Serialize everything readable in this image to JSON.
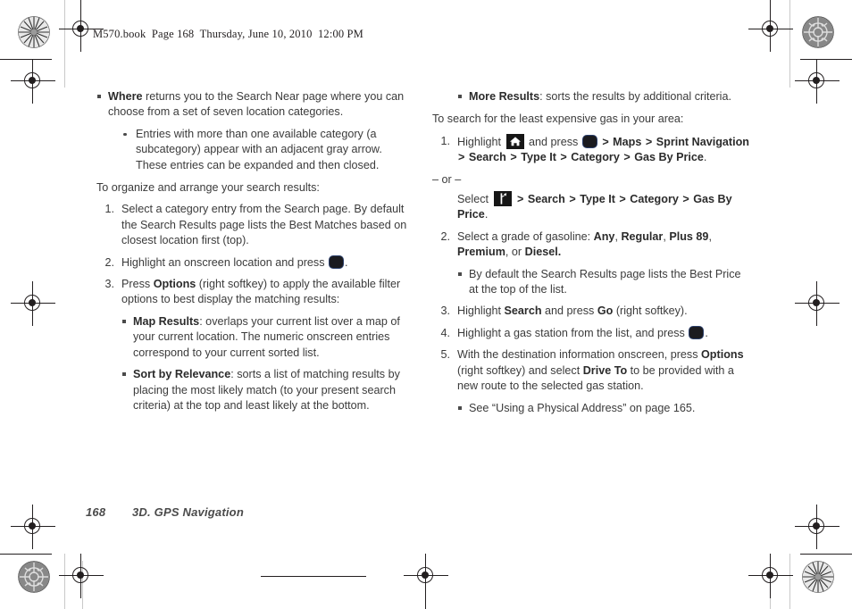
{
  "header": {
    "text": "M570.book  Page 168  Thursday, June 10, 2010  12:00 PM"
  },
  "footer": {
    "page_number": "168",
    "section": "3D. GPS Navigation"
  },
  "icons": {
    "ok_key": "ok-key-icon",
    "home": "home-icon",
    "navigation": "navigation-fork-icon"
  },
  "left_column": {
    "bullet_where": {
      "bold": "Where",
      "text": " returns you to the Search Near page where you can choose from a set of seven location categories."
    },
    "bullet_entries": "Entries with more than one available category (a subcategory) appear with an adjacent gray arrow. These entries can be expanded and then closed.",
    "intro": "To organize and arrange your search results:",
    "step1": {
      "num": "1.",
      "text": "Select a category entry from the Search page. By default the Search Results page lists the Best Matches based on closest location first (top)."
    },
    "step2": {
      "num": "2.",
      "text_before": "Highlight an onscreen location and press ",
      "text_after": "."
    },
    "step3": {
      "num": "3.",
      "text_before": "Press ",
      "bold": "Options",
      "text_after": " (right softkey) to apply the available filter options to best display the matching results:"
    },
    "bullet_map_results": {
      "bold": "Map Results",
      "text": ": overlaps your current list over a map of your current location. The numeric onscreen entries correspond to your current sorted list."
    },
    "bullet_sort_relevance": {
      "bold": "Sort by Relevance",
      "text": ": sorts a list of matching results by placing the most likely match (to your present search criteria) at the top and least likely at the bottom."
    }
  },
  "right_column": {
    "bullet_more_results": {
      "bold": "More Results",
      "text": ": sorts the results by additional criteria."
    },
    "intro": "To search for the least expensive gas in your area:",
    "step1": {
      "num": "1.",
      "text_highlight": "Highlight ",
      "text_and_press": " and press ",
      "path": [
        "Maps",
        "Sprint Navigation",
        "Search",
        "Type It",
        "Category",
        "Gas By Price"
      ],
      "period": "."
    },
    "or": "– or –",
    "alt": {
      "text_select": "Select ",
      "path": [
        "Search",
        "Type It",
        "Category",
        "Gas By Price"
      ],
      "period": "."
    },
    "step2": {
      "num": "2.",
      "text_before": "Select a grade of gasoline: ",
      "grades": [
        "Any",
        "Regular",
        "Plus 89",
        "Premium",
        "Diesel"
      ],
      "sep": ", ",
      "or_word": ", or ",
      "period": "."
    },
    "bullet_best_price": "By default the Search Results page lists the Best Price at the top of the list.",
    "step3": {
      "num": "3.",
      "text_before": "Highlight ",
      "bold_search": "Search",
      "text_middle": " and press ",
      "bold_go": "Go",
      "text_after": " (right softkey)."
    },
    "step4": {
      "num": "4.",
      "text_before": "Highlight a gas station from the list, and press ",
      "text_after": "."
    },
    "step5": {
      "num": "5.",
      "text_a": "With the destination information onscreen, press ",
      "bold_options": "Options",
      "text_b": " (right softkey) and select ",
      "bold_driveto": "Drive To",
      "text_c": " to be provided with a new route to the selected gas station."
    },
    "bullet_see": "See “Using a Physical Address” on page 165."
  },
  "colors": {
    "text": "#3b3b3b",
    "bold_text": "#2b2b2b",
    "key_border": "#2b3f6b",
    "key_fill": "#1b1b1f",
    "icon_fill": "#161616",
    "guide_line": "#c9c9c9"
  }
}
